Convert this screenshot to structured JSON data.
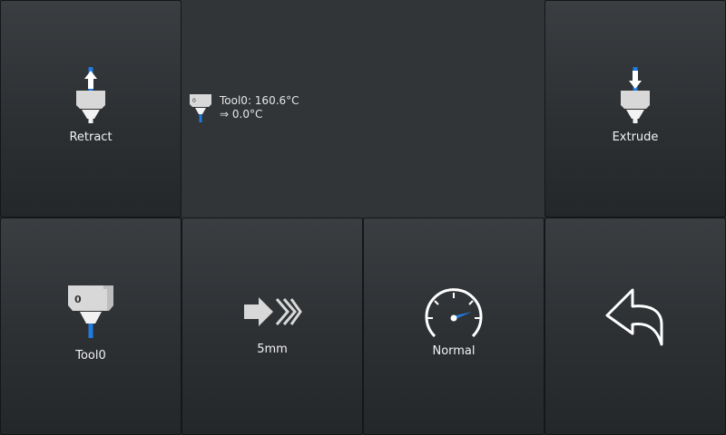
{
  "retract": {
    "label": "Retract"
  },
  "extrude": {
    "label": "Extrude"
  },
  "temperature": {
    "tool_label": "Tool0: 160.6°C",
    "target_label": "⇒ 0.0°C",
    "nozzle_number": "0"
  },
  "tool_button": {
    "label": "Tool0",
    "number": "0"
  },
  "distance_button": {
    "label": "5mm"
  },
  "speed_button": {
    "label": "Normal"
  },
  "colors": {
    "accent_blue": "#1e7be0",
    "icon_light": "#d9d9d9",
    "background": "#25282b"
  }
}
